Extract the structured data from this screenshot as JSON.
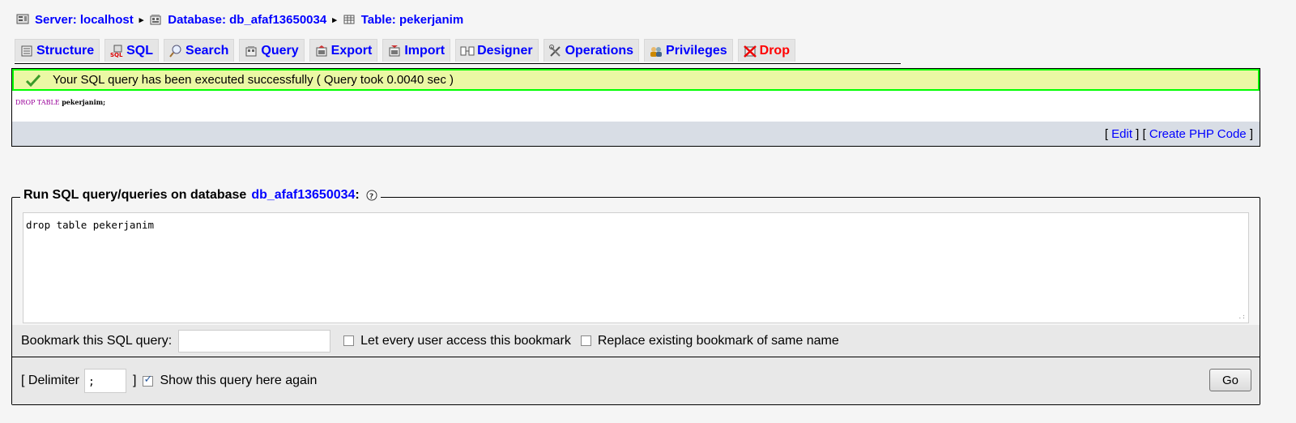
{
  "breadcrumb": {
    "server_label": "Server: localhost",
    "database_label": "Database: db_afaf13650034",
    "table_label": "Table: pekerjanim",
    "separator": "▸"
  },
  "tabs": [
    {
      "label": "Structure",
      "icon": "structure-icon"
    },
    {
      "label": "SQL",
      "icon": "sql-icon"
    },
    {
      "label": "Search",
      "icon": "search-icon"
    },
    {
      "label": "Query",
      "icon": "query-icon"
    },
    {
      "label": "Export",
      "icon": "export-icon"
    },
    {
      "label": "Import",
      "icon": "import-icon"
    },
    {
      "label": "Designer",
      "icon": "designer-icon"
    },
    {
      "label": "Operations",
      "icon": "operations-icon"
    },
    {
      "label": "Privileges",
      "icon": "privileges-icon"
    },
    {
      "label": "Drop",
      "icon": "drop-icon"
    }
  ],
  "result": {
    "message": "Your SQL query has been executed successfully ( Query took 0.0040 sec )",
    "query_keyword": "DROP TABLE",
    "query_table": "pekerjanim;",
    "edit_label": "Edit",
    "php_label": "Create PHP Code"
  },
  "sql_form": {
    "legend_prefix": "Run SQL query/queries on database",
    "database_link": "db_afaf13650034",
    "legend_suffix": ":",
    "query_text": "drop table pekerjanim",
    "bookmark_label": "Bookmark this SQL query:",
    "bookmark_value": "",
    "every_user_label": "Let every user access this bookmark",
    "replace_label": "Replace existing bookmark of same name",
    "delimiter_label": "[ Delimiter",
    "delimiter_value": ";",
    "delimiter_close": "]",
    "show_again_label": "Show this query here again",
    "show_again_checked": true,
    "go_label": "Go"
  },
  "colors": {
    "success_border": "#00ff00",
    "success_bg": "#ebf8a4",
    "link": "#0000ff",
    "drop": "#ff0000"
  }
}
